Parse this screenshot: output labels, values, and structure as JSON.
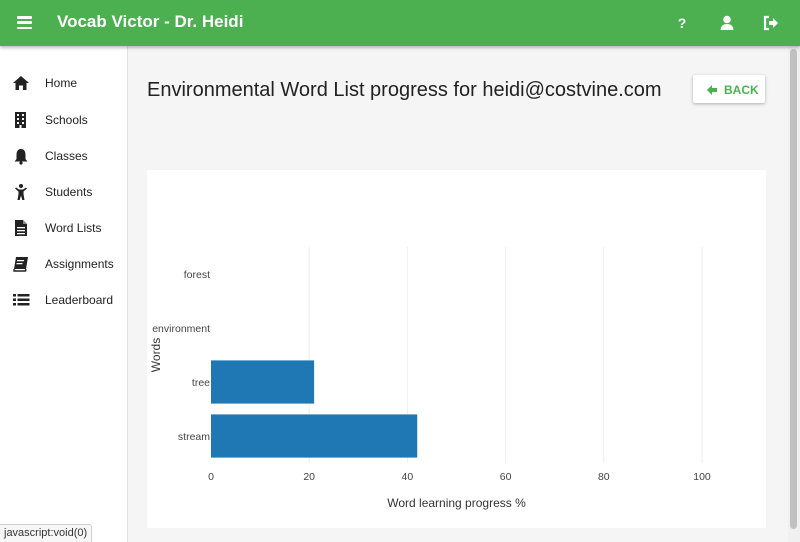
{
  "header": {
    "title": "Vocab Victor - Dr. Heidi",
    "menu_icon": "hamburger-icon",
    "icons": [
      "help-icon",
      "user-icon",
      "logout-icon"
    ],
    "help_label": "?",
    "bg_color": "#4caf50"
  },
  "sidebar": {
    "items": [
      {
        "label": "Home",
        "icon": "home-icon"
      },
      {
        "label": "Schools",
        "icon": "building-icon"
      },
      {
        "label": "Classes",
        "icon": "bell-icon"
      },
      {
        "label": "Students",
        "icon": "child-icon"
      },
      {
        "label": "Word Lists",
        "icon": "document-icon"
      },
      {
        "label": "Assignments",
        "icon": "book-icon"
      },
      {
        "label": "Leaderboard",
        "icon": "list-icon"
      }
    ]
  },
  "main": {
    "title": "Environmental Word List progress for heidi@costvine.com",
    "back_label": "BACK"
  },
  "chart_data": {
    "type": "bar",
    "orientation": "horizontal",
    "categories": [
      "forest",
      "environment",
      "tree",
      "stream"
    ],
    "values": [
      0,
      0,
      21,
      42
    ],
    "xlabel": "Word learning progress %",
    "ylabel": "Words",
    "xlim": [
      0,
      100
    ],
    "xticks": [
      0,
      20,
      40,
      60,
      80,
      100
    ],
    "bar_color": "#1f77b4",
    "grid": true
  },
  "status_bar": {
    "text": "javascript:void(0)"
  }
}
